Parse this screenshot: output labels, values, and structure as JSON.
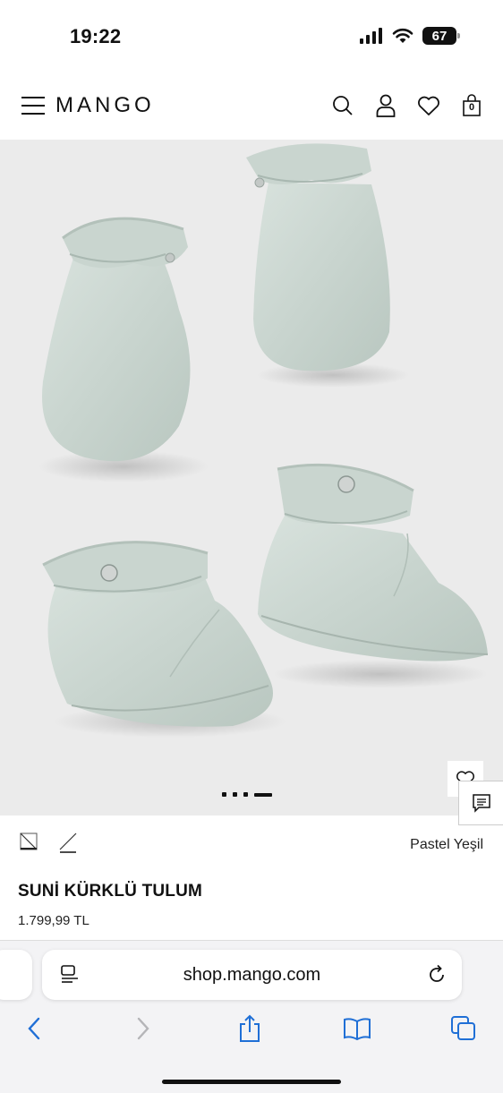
{
  "status_bar": {
    "time": "19:22",
    "battery": "67"
  },
  "header": {
    "logo": "MANGO",
    "bag_count": "0"
  },
  "product": {
    "color_name": "Pastel Yeşil",
    "name": "SUNİ KÜRKLÜ TULUM",
    "price": "1.799,99 TL",
    "image_alt": "Pastel green padded baby mittens and booties",
    "carousel": {
      "total": 4,
      "active": 4
    }
  },
  "browser": {
    "url": "shop.mango.com"
  },
  "colors": {
    "product": "#cdd8d3",
    "product_shadow": "#aebcb5",
    "background": "#ebebeb",
    "accent": "#1f6fd6"
  }
}
